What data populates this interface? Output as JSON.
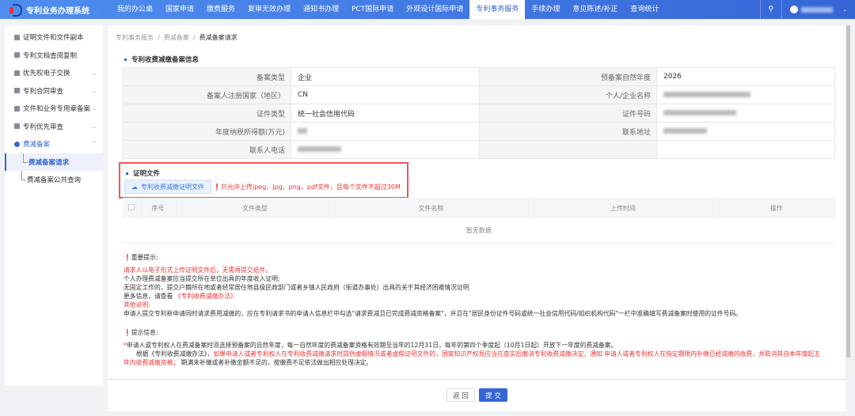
{
  "app": {
    "title": "专利业务办理系统"
  },
  "nav": [
    "我的办公桌",
    "国家申请",
    "缴费服务",
    "复审无效办理",
    "通知书办理",
    "PCT国际申请",
    "外观设计国际申请",
    "专利事务服务",
    "手续办理",
    "意见陈述/补正",
    "查询统计"
  ],
  "sidebar": {
    "items": [
      "证明文件和文件副本",
      "专利文档查阅复制",
      "优先权电子交换",
      "专利合同审查",
      "文件和业务专用章备案",
      "专利优先审查",
      "费减备案"
    ],
    "sub": [
      "费减备案请求",
      "费减备案公共查询"
    ]
  },
  "breadcrumb": [
    "专利事务服务",
    "费减备案",
    "费减备案请求"
  ],
  "info": {
    "title": "专利收费减缴备案信息",
    "rows": [
      {
        "l1": "备案类型",
        "v1": "企业",
        "l2": "预备案自然年度",
        "v2": "2026"
      },
      {
        "l1": "备案人注册国家（地区）",
        "v1": "CN",
        "l2": "个人/企业名称",
        "v2": ""
      },
      {
        "l1": "证件类型",
        "v1": "统一社会信用代码",
        "l2": "证件号码",
        "v2": ""
      },
      {
        "l1": "年度纳税所得额(万元)",
        "v1": "",
        "l2": "联系地址",
        "v2": ""
      },
      {
        "l1": "联系人电话",
        "v1": "",
        "l2": "",
        "v2": ""
      }
    ]
  },
  "proof": {
    "title": "证明文件",
    "upload": "专利收费减缴证明文件",
    "hint": "只允许上传jpeg、jpg、png、pdf文件，且每个文件不超过30M",
    "columns": [
      "序号",
      "文件类型",
      "文件名称",
      "上传时间",
      "操作"
    ],
    "empty": "暂无数据"
  },
  "notes": {
    "important": "重要提示:",
    "l1": "请求人以电子形式上传证明文件后，无需再提交纸件。",
    "l2": "个人办理费减备案应当提交所在单位出具的年度收入证明;",
    "l3": "无固定工作的，提交户籍所在地或者经常居住地县级民政部门或者乡镇人民政府（街道办事处）出具的关于其经济困难情况证明",
    "l4a": "更多信息，请查看 ",
    "l4b": "《专利收费减缴办法》",
    "l5": "其他说明:",
    "l6": "申请人提交专利新申请同时请求费用减缴的，应在专利请求书的申请人信息栏中勾选\"请求费减且已完成费减资格备案\"，并且在\"居民身份证件号码或统一社会信用代码/组织机构代码\"一栏中准确填写费减备案时使用的证件号码。",
    "tips": "提示信息:",
    "t1": "申请人或专利权人在费减备案时须选择预备案的自然年度，每一自然年度的费减备案资格有效期至当年的12月31日，每年的第四个季度起（10月1日起）开放下一年度的费减备案。",
    "t2a": "根据《专利收费减缴办法》，",
    "t2b": "如果申请人或者专利权人在专利收费减缴请求时提供虚假情况或者虚假证明文件的，国家知识产权局应当在查实后撤消专利收费减缴决定，通知 申请人或者专利权人在指定期限内补缴已经减缴的收费，并取消其自本年度起五",
    "t3a": "年内收费减缴资格；",
    "t3b": " 期满未补缴或者补缴金额不足的，按缴费不足依法做出相应处理决定。"
  },
  "footer": {
    "back": "返 回",
    "submit": "提 交"
  }
}
